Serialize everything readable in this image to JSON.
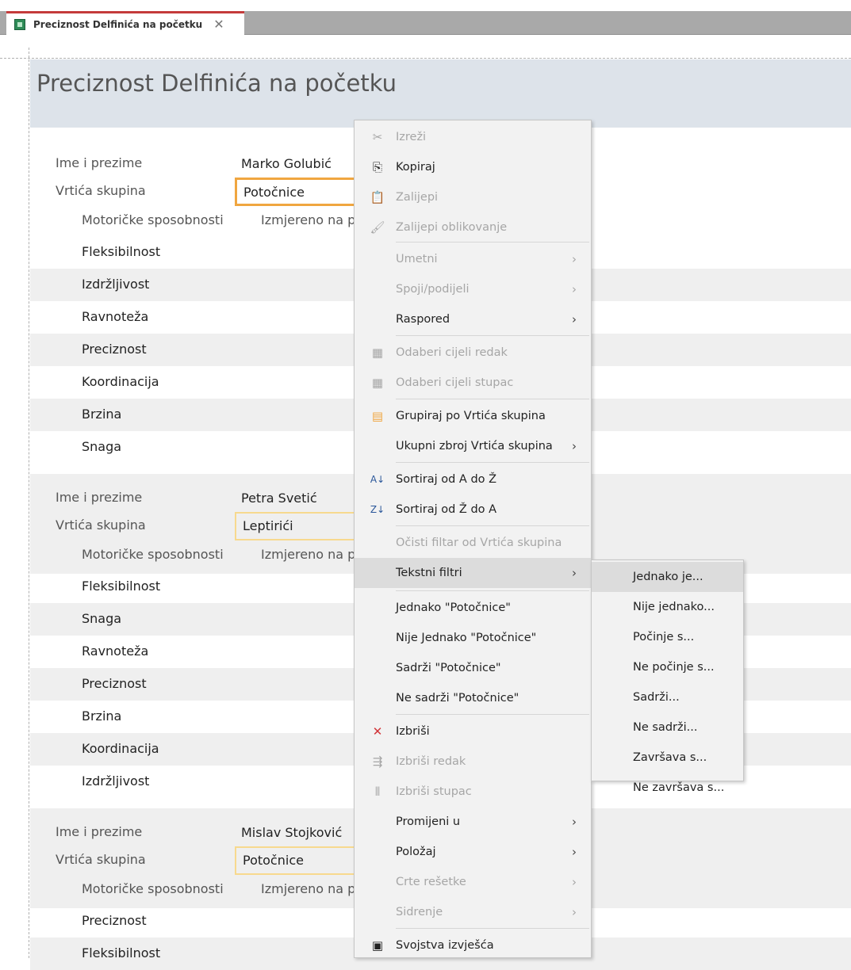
{
  "tab": {
    "title": "Preciznost Delfinića na početku",
    "close_glyph": "✕"
  },
  "report": {
    "title": "Preciznost Delfinića na početku",
    "label_name": "Ime i prezime",
    "label_group": "Vrtića skupina",
    "label_skills": "Motoričke sposobnosti",
    "label_measured": "Izmjereno na p",
    "records": [
      {
        "name": "Marko Golubić",
        "group": "Potočnice",
        "items": [
          "Fleksibilnost",
          "Izdržljivost",
          "Ravnoteža",
          "Preciznost",
          "Koordinacija",
          "Brzina",
          "Snaga"
        ]
      },
      {
        "name": "Petra Svetić",
        "group": "Leptirići",
        "items": [
          "Fleksibilnost",
          "Snaga",
          "Ravnoteža",
          "Preciznost",
          "Brzina",
          "Koordinacija",
          "Izdržljivost"
        ]
      },
      {
        "name": "Mislav Stojković",
        "group": "Potočnice",
        "items": [
          "Preciznost",
          "Fleksibilnost"
        ]
      }
    ]
  },
  "context_menu": {
    "items": [
      {
        "label": "Izreži",
        "icon": "scissors-icon",
        "glyph": "✂",
        "disabled": true
      },
      {
        "label": "Kopiraj",
        "icon": "copy-icon",
        "glyph": "⎘",
        "disabled": false
      },
      {
        "label": "Zalijepi",
        "icon": "paste-icon",
        "glyph": "📋",
        "disabled": true
      },
      {
        "label": "Zalijepi oblikovanje",
        "icon": "format-painter-icon",
        "glyph": "🖌",
        "disabled": true
      },
      {
        "label": "Umetni",
        "disabled": true,
        "submenu": true
      },
      {
        "label": "Spoji/podijeli",
        "disabled": true,
        "submenu": true
      },
      {
        "label": "Raspored",
        "disabled": false,
        "submenu": true
      },
      {
        "label": "Odaberi cijeli redak",
        "icon": "grid-row-icon",
        "glyph": "▦",
        "disabled": true
      },
      {
        "label": "Odaberi cijeli stupac",
        "icon": "grid-column-icon",
        "glyph": "▦",
        "disabled": true
      },
      {
        "label": "Grupiraj po Vrtića skupina",
        "icon": "group-icon",
        "glyph": "▤",
        "disabled": false
      },
      {
        "label": "Ukupni zbroj Vrtića skupina",
        "disabled": false,
        "submenu": true
      },
      {
        "label": "Sortiraj od A do Ž",
        "icon": "sort-asc-icon",
        "glyph": "A↓",
        "disabled": false
      },
      {
        "label": "Sortiraj od Ž do A",
        "icon": "sort-desc-icon",
        "glyph": "Z↓",
        "disabled": false
      },
      {
        "label": "Očisti filtar od Vrtića skupina",
        "disabled": true
      },
      {
        "label": "Tekstni filtri",
        "disabled": false,
        "submenu": true,
        "highlighted": true
      },
      {
        "label": "Jednako \"Potočnice\"",
        "disabled": false
      },
      {
        "label": "Nije Jednako \"Potočnice\"",
        "disabled": false
      },
      {
        "label": "Sadrži \"Potočnice\"",
        "disabled": false
      },
      {
        "label": "Ne sadrži \"Potočnice\"",
        "disabled": false
      },
      {
        "label": "Izbriši",
        "icon": "delete-icon",
        "glyph": "✕",
        "disabled": false
      },
      {
        "label": "Izbriši redak",
        "icon": "delete-row-icon",
        "glyph": "⇶",
        "disabled": true
      },
      {
        "label": "Izbriši stupac",
        "icon": "delete-column-icon",
        "glyph": "⫴",
        "disabled": true
      },
      {
        "label": "Promijeni u",
        "disabled": false,
        "submenu": true
      },
      {
        "label": "Položaj",
        "disabled": false,
        "submenu": true
      },
      {
        "label": "Crte rešetke",
        "disabled": true,
        "submenu": true
      },
      {
        "label": "Sidrenje",
        "disabled": true,
        "submenu": true
      },
      {
        "label": "Svojstva izvješća",
        "icon": "properties-icon",
        "glyph": "▣",
        "disabled": false
      }
    ]
  },
  "text_filters_submenu": {
    "items": [
      "Jednako je...",
      "Nije jednako...",
      "Počinje s...",
      "Ne počinje s...",
      "Sadrži...",
      "Ne sadrži...",
      "Završava s...",
      "Ne završava s..."
    ]
  },
  "colors": {
    "accent_orange": "#f0a640",
    "delete_red": "#d13438",
    "header_band": "#dde3ea"
  }
}
